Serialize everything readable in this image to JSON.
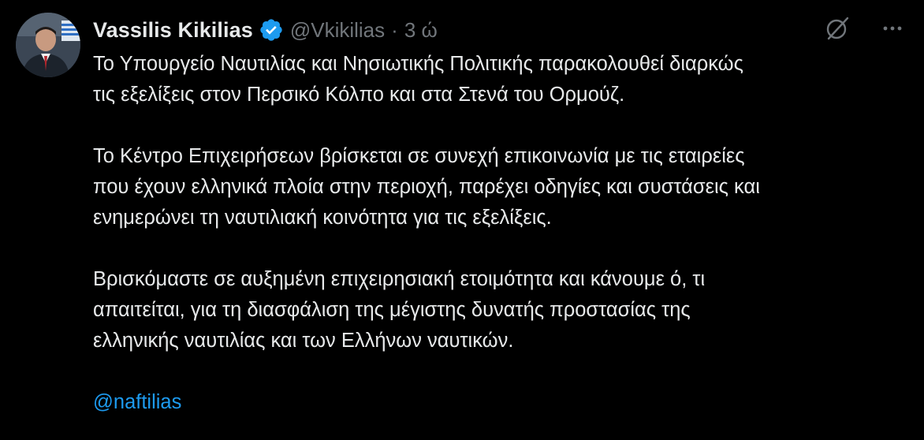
{
  "author": {
    "name": "Vassilis Kikilias",
    "handle": "@Vkikilias",
    "separator": "·",
    "time": "3 ώ",
    "verified": true
  },
  "icons": {
    "verified": "verified-badge-icon",
    "grok": "grok-icon",
    "more": "more-options-icon"
  },
  "colors": {
    "background": "#000000",
    "text": "#e7e9ea",
    "muted": "#71767b",
    "accent": "#1d9bf0"
  },
  "tweet": {
    "paragraphs": [
      "Το Υπουργείο Ναυτιλίας και Νησιωτικής Πολιτικής παρακολουθεί διαρκώς\nτις εξελίξεις στον Περσικό Κόλπο και στα Στενά του Ορμούζ.",
      "Το Κέντρο Επιχειρήσεων βρίσκεται σε συνεχή επικοινωνία με τις εταιρείες\nπου έχουν ελληνικά πλοία στην περιοχή,  παρέχει οδηγίες και συστάσεις και\nενημερώνει τη ναυτιλιακή κοινότητα για τις εξελίξεις.",
      "Βρισκόμαστε σε αυξημένη επιχειρησιακή ετοιμότητα και κάνουμε ό, τι\nαπαιτείται, για τη διασφάλιση της μέγιστης δυνατής προστασίας της\nελληνικής ναυτιλίας και των Ελλήνων ναυτικών."
    ],
    "mention": "@naftilias"
  }
}
